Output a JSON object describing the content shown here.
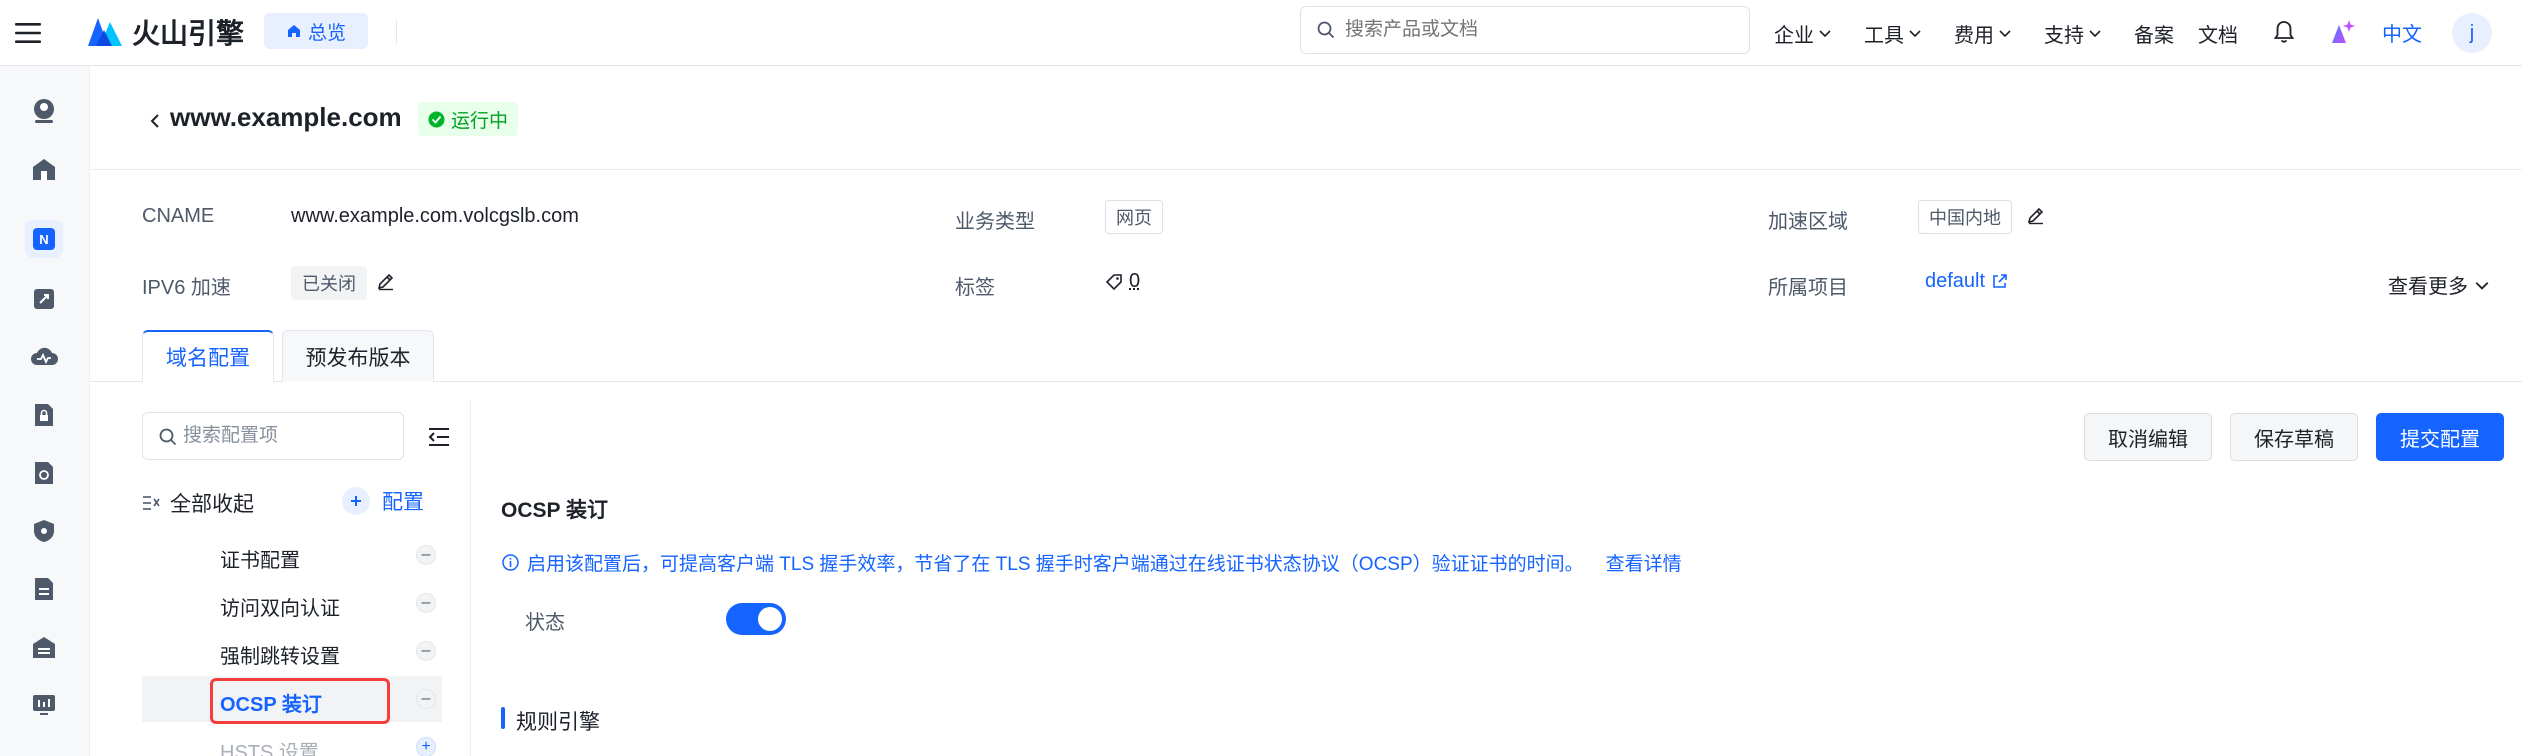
{
  "topbar": {
    "brand": "火山引擎",
    "overview": "总览",
    "search_placeholder": "搜索产品或文档",
    "nav": [
      {
        "label": "企业"
      },
      {
        "label": "工具"
      },
      {
        "label": "费用"
      },
      {
        "label": "支持"
      },
      {
        "label": "备案"
      },
      {
        "label": "文档"
      }
    ],
    "lang": "中文",
    "avatar": "j"
  },
  "header": {
    "domain": "www.example.com",
    "status": "运行中",
    "colors": {
      "accent": "#1664ff",
      "success": "#00b42a"
    }
  },
  "info": {
    "cname_label": "CNAME",
    "cname_value": "www.example.com.volcgslb.com",
    "biz_label": "业务类型",
    "biz_value": "网页",
    "area_label": "加速区域",
    "area_value": "中国内地",
    "ipv6_label": "IPV6 加速",
    "ipv6_value": "已关闭",
    "tags_label": "标签",
    "tags_value": "0",
    "project_label": "所属项目",
    "project_value": "default",
    "more": "查看更多"
  },
  "tabs": [
    {
      "label": "域名配置",
      "active": true
    },
    {
      "label": "预发布版本",
      "active": false
    }
  ],
  "sidebar": {
    "search_placeholder": "搜索配置项",
    "collapse_all": "全部收起",
    "config": "配置",
    "items": [
      {
        "label": "证书配置"
      },
      {
        "label": "访问双向认证"
      },
      {
        "label": "强制跳转设置"
      },
      {
        "label": "OCSP 装订",
        "selected": true
      },
      {
        "label": "HSTS 设置"
      }
    ]
  },
  "actions": {
    "cancel": "取消编辑",
    "save_draft": "保存草稿",
    "submit": "提交配置"
  },
  "ocsp": {
    "title": "OCSP 装订",
    "info": "启用该配置后，可提高客户端 TLS 握手效率，节省了在 TLS 握手时客户端通过在线证书状态协议（OCSP）验证证书的时间。",
    "detail_link": "查看详情",
    "status_label": "状态",
    "enabled": true
  },
  "rules": {
    "title": "规则引擎"
  }
}
